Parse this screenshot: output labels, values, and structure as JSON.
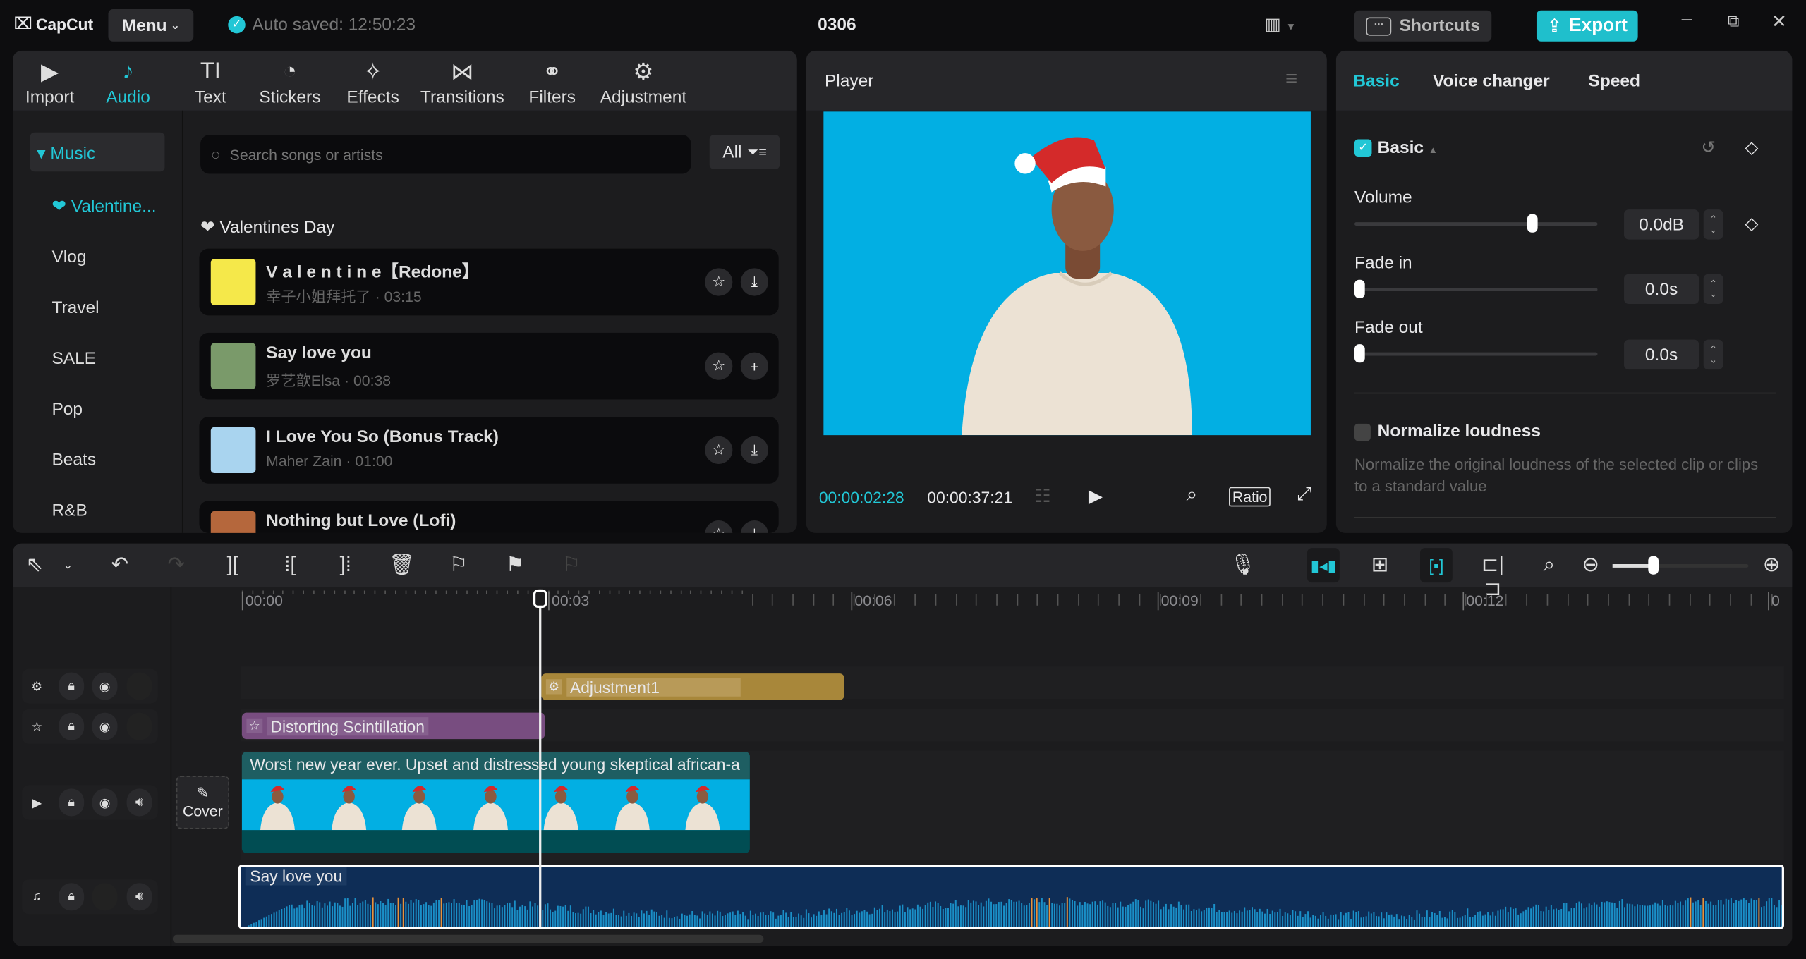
{
  "app": {
    "logo": "CapCut",
    "menu": "Menu",
    "autosave": "Auto saved: 12:50:23",
    "project_title": "0306",
    "shortcuts": "Shortcuts",
    "export": "Export"
  },
  "toolbar": {
    "items": [
      {
        "label": "Import",
        "icon": "import-icon"
      },
      {
        "label": "Audio",
        "icon": "audio-icon",
        "active": true
      },
      {
        "label": "Text",
        "icon": "text-icon"
      },
      {
        "label": "Stickers",
        "icon": "sticker-icon"
      },
      {
        "label": "Effects",
        "icon": "effects-icon"
      },
      {
        "label": "Transitions",
        "icon": "transitions-icon"
      },
      {
        "label": "Filters",
        "icon": "filters-icon"
      },
      {
        "label": "Adjustment",
        "icon": "adjustment-icon"
      }
    ]
  },
  "sidebar": {
    "section": "Music",
    "items": [
      "Valentine...",
      "Vlog",
      "Travel",
      "SALE",
      "Pop",
      "Beats",
      "R&B"
    ]
  },
  "search": {
    "placeholder": "Search songs or artists",
    "filter": "All"
  },
  "playlist": {
    "title": "Valentines Day",
    "songs": [
      {
        "title": "V a l e n t i n e【Redone】",
        "sub": "幸子小姐拜托了 · 03:15",
        "action": "download"
      },
      {
        "title": "Say love you",
        "sub": "罗艺歆Elsa · 00:38",
        "action": "add"
      },
      {
        "title": "I Love You So (Bonus Track)",
        "sub": "Maher Zain · 01:00",
        "action": "download"
      },
      {
        "title": "Nothing but Love (Lofi)",
        "sub": "",
        "action": "download"
      }
    ]
  },
  "player": {
    "title": "Player",
    "current": "00:00:02:28",
    "total": "00:00:37:21",
    "ratio": "Ratio"
  },
  "inspector": {
    "tabs": [
      "Basic",
      "Voice changer",
      "Speed"
    ],
    "section": "Basic",
    "volume_label": "Volume",
    "volume": "0.0dB",
    "volume_fraction": 0.73,
    "fadein_label": "Fade in",
    "fadein": "0.0s",
    "fadeout_label": "Fade out",
    "fadeout": "0.0s",
    "normalize_label": "Normalize loudness",
    "normalize_desc": "Normalize the original loudness of the selected clip or clips to a standard value",
    "normalize_checked": false
  },
  "timeline": {
    "ruler": [
      "00:00",
      "00:03",
      "00:06",
      "00:09",
      "00:12",
      "0"
    ],
    "zoom_fraction": 0.3,
    "clips": {
      "adjustment": "Adjustment1",
      "effect": "Distorting Scintillation",
      "video": "Worst new year ever. Upset and distressed young skeptical african-a",
      "audio": "Say love you"
    },
    "cover": "Cover"
  },
  "colors": {
    "accent": "#22c7d6",
    "adjustment": "#a8873a",
    "effect": "#7a4f86",
    "video": "#1e5e62",
    "audio": "#0e2d56"
  }
}
